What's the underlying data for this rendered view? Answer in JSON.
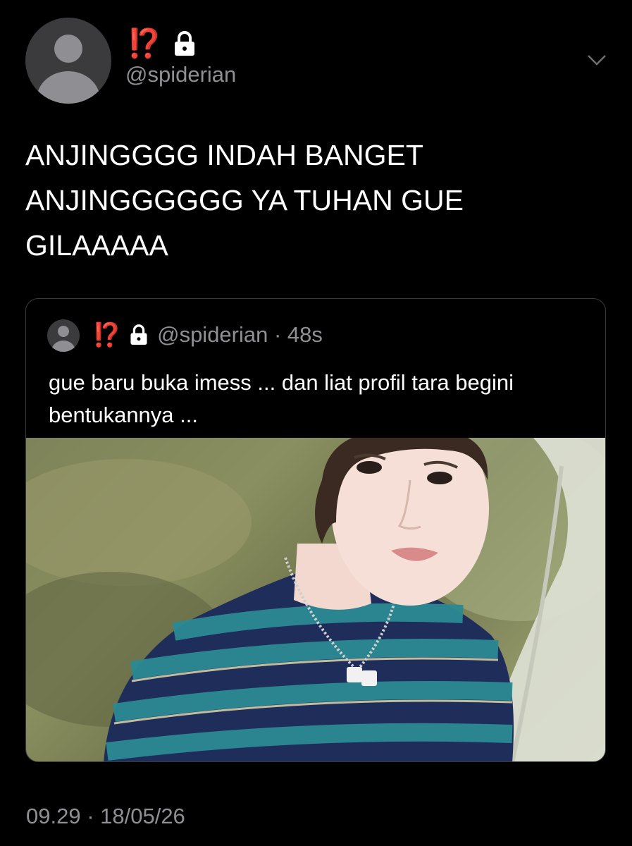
{
  "author": {
    "display_name": "⁉️",
    "handle": "@spiderian",
    "locked_icon": "lock-icon"
  },
  "tweet": {
    "text": "ANJINGGGG INDAH BANGET ANJINGGGGGG YA TUHAN GUE GILAAAAA",
    "time": "09.29 · 18/05/26"
  },
  "quote": {
    "display_name": "⁉️",
    "handle_time": "@spiderian · 48s",
    "text": "gue baru buka imess ... dan liat profil tara begini bentukannya ...",
    "image_alt": "photo of a young man in a blue striped t-shirt"
  },
  "colors": {
    "background": "#000000",
    "muted_text": "#8f8f94",
    "warn": "#f2382f",
    "border": "#3a3a3c"
  }
}
